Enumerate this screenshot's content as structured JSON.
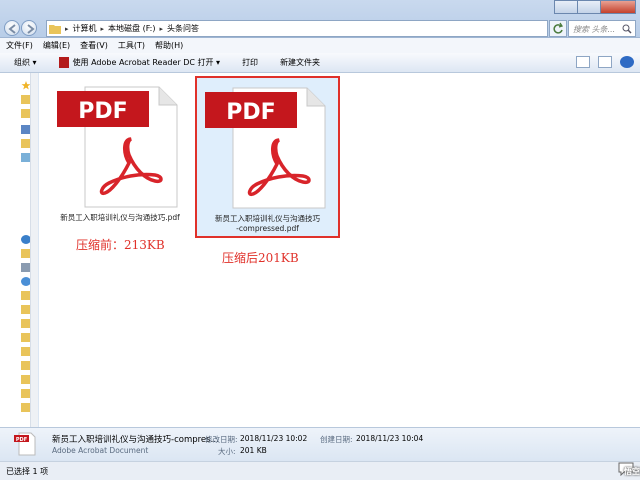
{
  "address": {
    "crumbs": [
      "计算机",
      "本地磁盘 (F:)",
      "头条问答"
    ],
    "search_placeholder": "搜索 头条..."
  },
  "menu": [
    "文件(F)",
    "编辑(E)",
    "查看(V)",
    "工具(T)",
    "帮助(H)"
  ],
  "toolbar": {
    "organize": "组织 ▾",
    "open_with": "使用 Adobe Acrobat Reader DC 打开 ▾",
    "print": "打印",
    "new_folder": "新建文件夹"
  },
  "files": [
    {
      "name": "新员工入职培训礼仪与沟通技巧.pdf",
      "icon_text": "PDF"
    },
    {
      "name_line1": "新员工入职培训礼仪与沟通技巧",
      "name_line2": "-compressed.pdf",
      "icon_text": "PDF"
    }
  ],
  "annotations": {
    "before": "压缩前：213KB",
    "after": "压缩后201KB"
  },
  "details": {
    "name": "新员工入职培训礼仪与沟通技巧-compres...",
    "type": "Adobe Acrobat Document",
    "modified_label": "修改日期:",
    "modified_value": "2018/11/23 10:02",
    "created_label": "创建日期:",
    "created_value": "2018/11/23 10:04",
    "size_label": "大小:",
    "size_value": "201 KB"
  },
  "status": "已选择 1 项",
  "watermark": "悟空问答",
  "colors": {
    "accent_red": "#e0312a",
    "pdf_banner": "#c4171d",
    "selection": "#dfeefc"
  }
}
